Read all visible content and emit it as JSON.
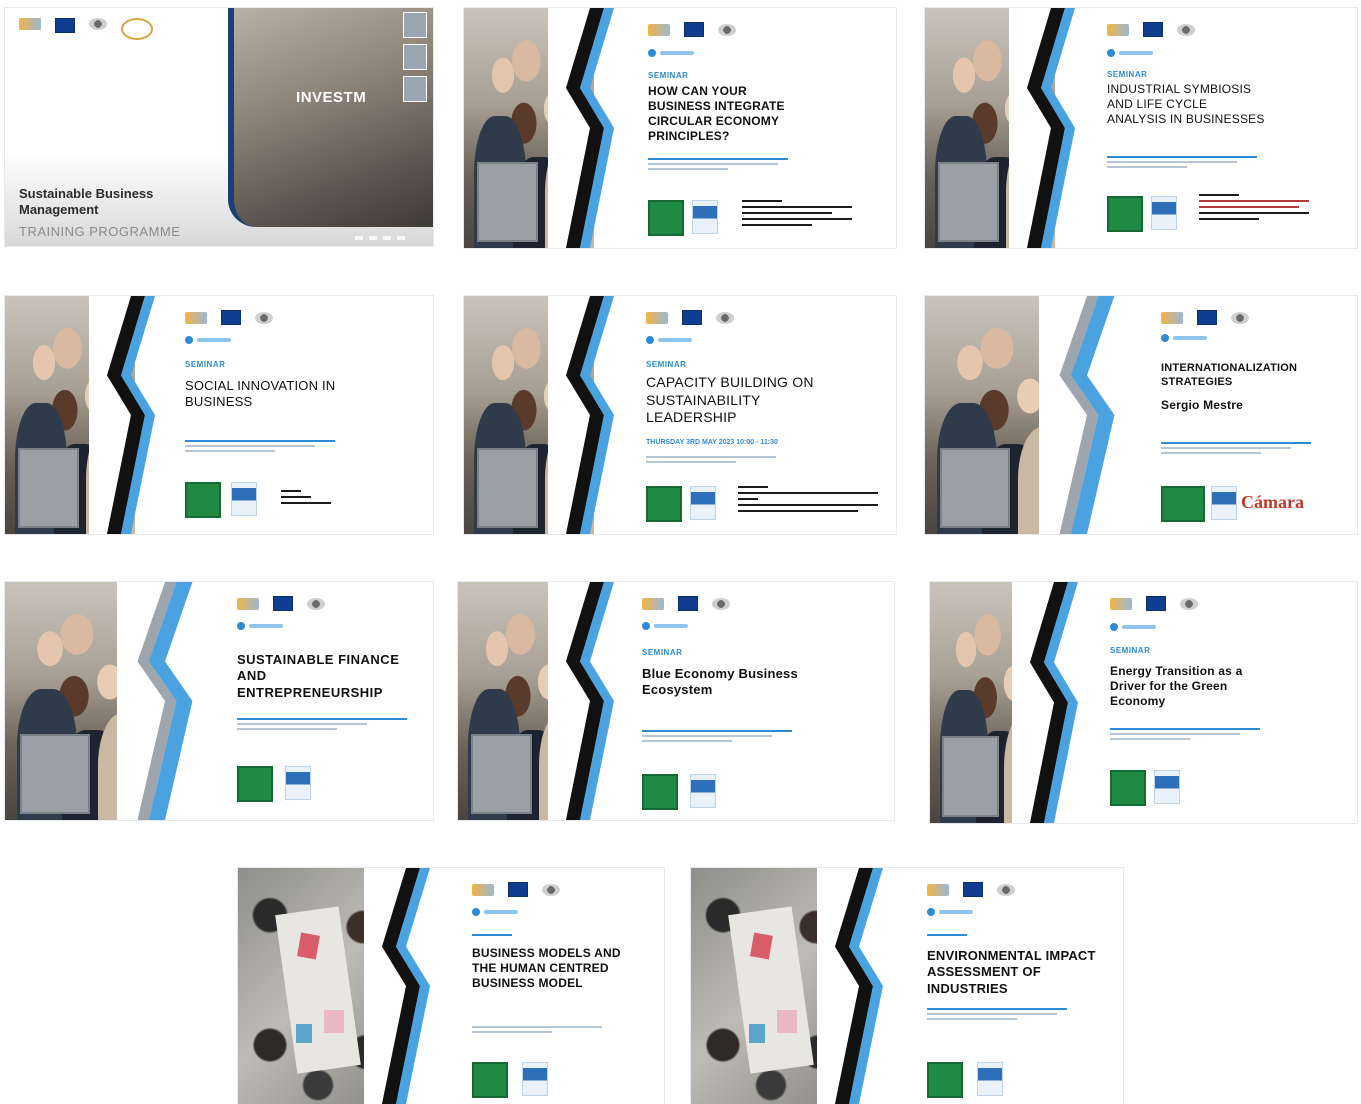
{
  "cards": [
    {
      "kicker": "",
      "title": "INVESTM",
      "subtitle_line1": "Sustainable Business",
      "subtitle_line2": "Management",
      "subtitle_line3": "TRAINING PROGRAMME"
    },
    {
      "kicker": "SEMINAR",
      "title": "HOW CAN YOUR BUSINESS INTEGRATE CIRCULAR ECONOMY PRINCIPLES?"
    },
    {
      "kicker": "SEMINAR",
      "title": "INDUSTRIAL SYMBIOSIS AND LIFE CYCLE ANALYSIS IN BUSINESSES"
    },
    {
      "kicker": "SEMINAR",
      "title": "SOCIAL INNOVATION IN BUSINESS"
    },
    {
      "kicker": "SEMINAR",
      "title": "CAPACITY BUILDING ON SUSTAINABILITY LEADERSHIP",
      "date": "THURSDAY 3RD MAY 2023 10:00 - 11:30"
    },
    {
      "kicker": "",
      "title": "INTERNATIONALIZATION STRATEGIES",
      "speaker": "Sergio Mestre",
      "partner": "Cámara"
    },
    {
      "kicker": "",
      "title": "SUSTAINABLE FINANCE AND ENTREPRENEURSHIP"
    },
    {
      "kicker": "SEMINAR",
      "title": "Blue Economy Business Ecosystem"
    },
    {
      "kicker": "SEMINAR",
      "title": "Energy Transition as a Driver for the Green Economy"
    },
    {
      "kicker": "",
      "title": "BUSINESS MODELS AND THE HUMAN CENTRED BUSINESS MODEL"
    },
    {
      "kicker": "",
      "title": "ENVIRONMENTAL IMPACT ASSESSMENT OF INDUSTRIES"
    }
  ],
  "colors": {
    "accent_blue": "#2e8bd6",
    "light_blue": "#8ec5ef",
    "dark": "#111111",
    "green": "#1f8a43"
  }
}
